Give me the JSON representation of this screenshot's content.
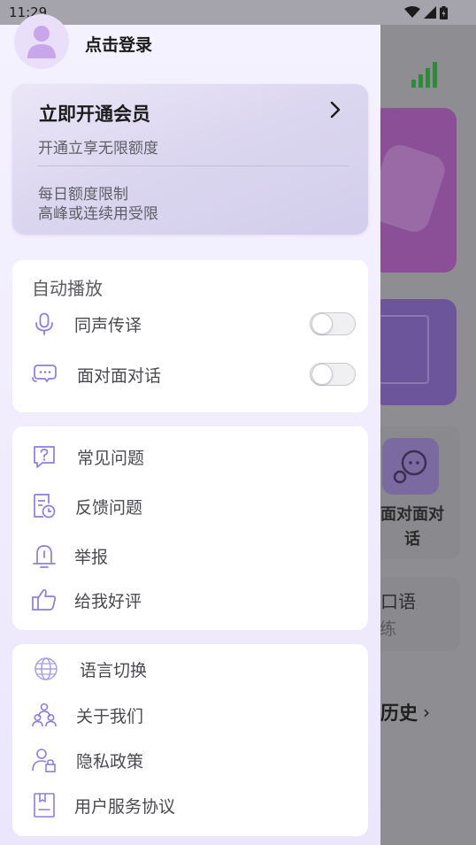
{
  "status_bar": {
    "time": "11:29"
  },
  "drawer": {
    "login_label": "点击登录",
    "vip": {
      "title": "立即开通会员",
      "subtitle": "开通立享无限额度",
      "note_line1": "每日额度限制",
      "note_line2": "高峰或连续用受限"
    },
    "autoplay": {
      "title": "自动播放",
      "items": [
        {
          "label": "同声传译",
          "icon": "microphone-icon",
          "toggle_on": false
        },
        {
          "label": "面对面对话",
          "icon": "chat-bubbles-icon",
          "toggle_on": false
        }
      ]
    },
    "help": {
      "items": [
        {
          "label": "常见问题",
          "icon": "question-icon"
        },
        {
          "label": "反馈问题",
          "icon": "feedback-icon"
        },
        {
          "label": "举报",
          "icon": "alert-bell-icon"
        },
        {
          "label": "给我好评",
          "icon": "thumbs-up-icon"
        }
      ]
    },
    "about": {
      "items": [
        {
          "label": "语言切换",
          "icon": "globe-icon"
        },
        {
          "label": "关于我们",
          "icon": "team-icon"
        },
        {
          "label": "隐私政策",
          "icon": "privacy-user-lock-icon"
        },
        {
          "label": "用户服务协议",
          "icon": "agreement-doc-icon"
        }
      ]
    }
  },
  "background_app": {
    "chat_label": "面对面对话",
    "oral_label": "练口语",
    "oral_sub": "陪练",
    "history_label": "历史"
  },
  "colors": {
    "accent": "#8f7de0",
    "drawer_bg": "#f3f0fe",
    "card_bg": "#ffffff"
  }
}
